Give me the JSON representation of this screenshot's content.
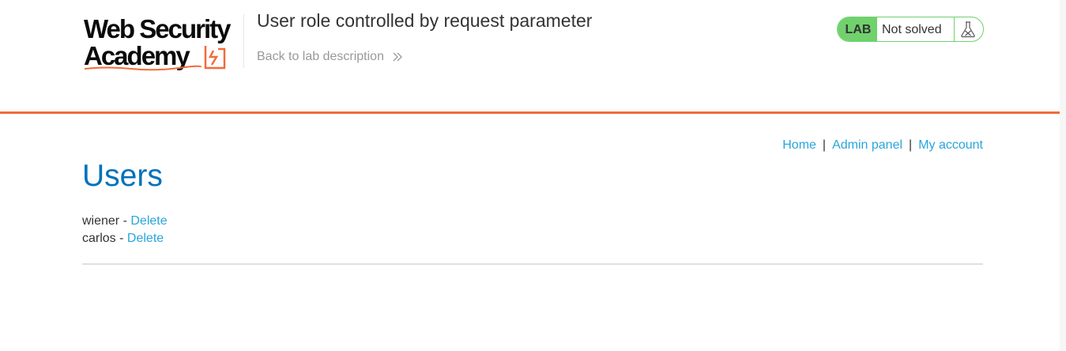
{
  "brand": {
    "line1": "Web Security",
    "line2": "Academy",
    "accent_color": "#f26b3a"
  },
  "lab": {
    "title": "User role controlled by request parameter",
    "back_link": "Back to lab description",
    "badge": "LAB",
    "status": "Not solved",
    "status_color": "#70d16d",
    "status_icon": "flask-icon"
  },
  "nav": {
    "home": "Home",
    "admin_panel": "Admin panel",
    "my_account": "My account",
    "separator": "|"
  },
  "page": {
    "heading": "Users",
    "heading_color": "#0071bc",
    "users": [
      {
        "name": "wiener",
        "separator": "-",
        "action": "Delete"
      },
      {
        "name": "carlos",
        "separator": "-",
        "action": "Delete"
      }
    ],
    "link_color": "#29a5dc"
  }
}
